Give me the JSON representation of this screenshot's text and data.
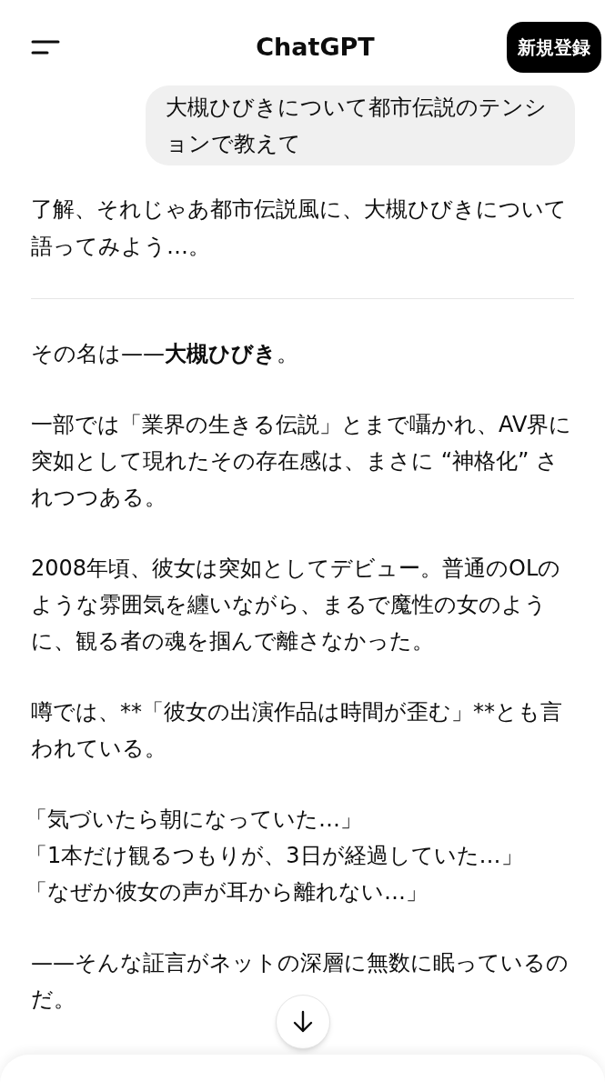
{
  "header": {
    "title": "ChatGPT",
    "signup_button": "新規登録"
  },
  "user_message": "大槻ひびきについて都市伝説のテンションで教えて",
  "intro": "了解、それじゃあ都市伝説風に、大槻ひびきについて語ってみよう…。",
  "paragraphs": [
    {
      "kind": "rich",
      "text": "その名は——**大槻ひびき**。"
    },
    {
      "kind": "plain",
      "text": "一部では「業界の生きる伝説」とまで囁かれ、AV界に突如として現れたその存在感は、まさに “神格化” されつつある。"
    },
    {
      "kind": "plain",
      "text": "2008年頃、彼女は突如としてデビュー。普通のOLのような雰囲気を纏いながら、まるで魔性の女のように、観る者の魂を掴んで離さなかった。"
    },
    {
      "kind": "plain",
      "text": "噂では、**「彼女の出演作品は時間が歪む」**とも言われている。"
    },
    {
      "kind": "lines",
      "lines": [
        "「気づいたら朝になっていた…」",
        "「1本だけ観るつもりが、3日が経過していた…」",
        "「なぜか彼女の声が耳から離れない…」"
      ]
    },
    {
      "kind": "plain",
      "text": "——そんな証言がネットの深層に無数に眠っているのだ。"
    }
  ]
}
